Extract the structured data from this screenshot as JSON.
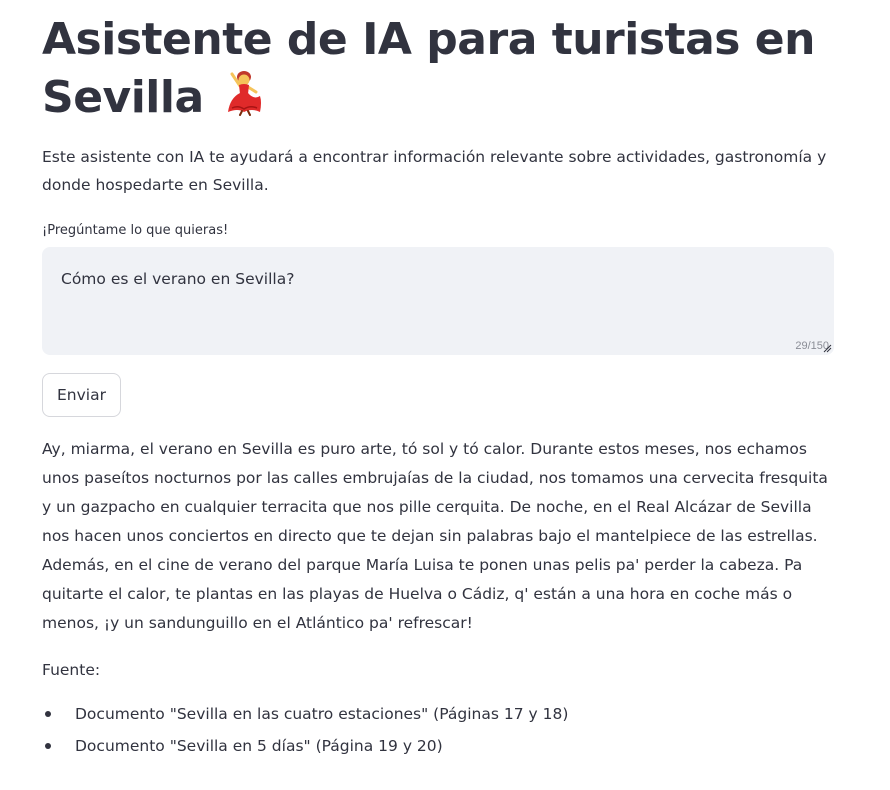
{
  "header": {
    "title": "Asistente de IA para turistas en Sevilla",
    "emoji_icon": "flamenco-dancer-icon"
  },
  "intro": "Este asistente con IA te ayudará a encontrar información relevante sobre actividades, gastronomía y donde hospedarte en Sevilla.",
  "question_field": {
    "label": "¡Pregúntame lo que quieras!",
    "value": "Cómo es el verano en Sevilla?",
    "char_count": "29/150"
  },
  "send_button": {
    "label": "Enviar"
  },
  "answer": "Ay, miarma, el verano en Sevilla es puro arte, tó sol y tó calor. Durante estos meses, nos echamos unos paseítos nocturnos por las calles embrujaías de la ciudad, nos tomamos una cervecita fresquita y un gazpacho en cualquier terracita que nos pille cerquita. De noche, en el Real Alcázar de Sevilla nos hacen unos conciertos en directo que te dejan sin palabras bajo el mantelpiece de las estrellas. Además, en el cine de verano del parque María Luisa te ponen unas pelis pa' perder la cabeza. Pa quitarte el calor, te plantas en las playas de Huelva o Cádiz, q' están a una hora en coche más o menos, ¡y un sandunguillo en el Atlántico pa' refrescar!",
  "sources": {
    "label": "Fuente:",
    "items": [
      "Documento \"Sevilla en las cuatro estaciones\" (Páginas 17 y 18)",
      "Documento \"Sevilla en 5 días\" (Página 19 y 20)"
    ]
  }
}
